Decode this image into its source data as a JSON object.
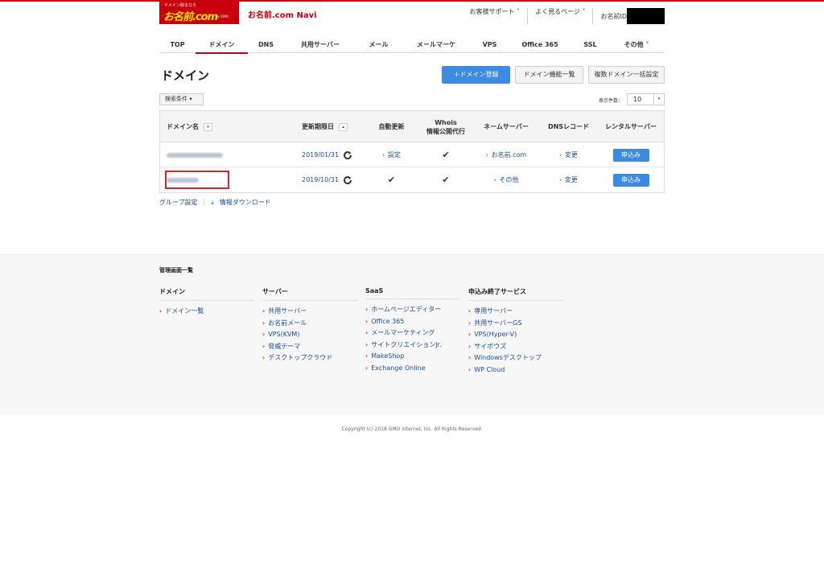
{
  "header": {
    "logo_tag": "ドメイン取るなら",
    "logo_main": "お名前.com",
    "logo_sub": "by GMO",
    "navi_title": "お名前.com Navi",
    "links": [
      "お客様サポート ˅",
      "よく見るページ ˅"
    ],
    "user_id_label": "お名前ID"
  },
  "gnav": [
    {
      "label": "TOP",
      "w": 45
    },
    {
      "label": "ドメイン",
      "w": 65,
      "active": true
    },
    {
      "label": "DNS",
      "w": 45
    },
    {
      "label": "共用サーバー",
      "w": 90
    },
    {
      "label": "メール",
      "w": 55
    },
    {
      "label": "メールマーケ",
      "w": 88
    },
    {
      "label": "VPS",
      "w": 45
    },
    {
      "label": "Office 365",
      "w": 80
    },
    {
      "label": "SSL",
      "w": 45
    },
    {
      "label": "その他 ˅",
      "w": 70
    }
  ],
  "page": {
    "title": "ドメイン",
    "register_button": "＋ドメイン登録",
    "features_button": "ドメイン機能一覧",
    "bulk_button": "複数ドメイン一括設定",
    "search_conditions": "検索条件 ▾",
    "display_count_label": "表示件数：",
    "display_count_value": "10"
  },
  "table": {
    "headers": {
      "domain": "ドメイン名",
      "expiry": "更新期限日",
      "auto_renew": "自動更新",
      "whois1": "Whois",
      "whois2": "情報公開代行",
      "nameserver": "ネームサーバー",
      "dns": "DNSレコード",
      "rental": "レンタルサーバー"
    },
    "rows": [
      {
        "expiry": "2019/01/31",
        "auto_renew": "設定",
        "whois": "✔",
        "nameserver": "お名前.com",
        "dns": "変更",
        "rental": "申込み"
      },
      {
        "expiry": "2019/10/31",
        "auto_renew": "✔",
        "whois": "✔",
        "nameserver": "その他",
        "dns": "変更",
        "rental": "申込み"
      }
    ]
  },
  "under_links": {
    "group": "グループ設定",
    "download": "情報ダウンロード"
  },
  "footer": {
    "title": "管理画面一覧",
    "columns": [
      {
        "heading": "ドメイン",
        "items": [
          "ドメイン一覧"
        ]
      },
      {
        "heading": "サーバー",
        "items": [
          "共用サーバー",
          "お名前メール",
          "VPS(KVM)",
          "脅威テーマ",
          "デスクトップクラウド"
        ]
      },
      {
        "heading": "SaaS",
        "items": [
          "ホームページエディター",
          "Office 365",
          "メールマーケティング",
          "サイトクリエイションJr.",
          "MakeShop",
          "Exchange Online"
        ]
      },
      {
        "heading": "申込み終了サービス",
        "items": [
          "専用サーバー",
          "共用サーバーGS",
          "VPS(Hyper-V)",
          "サイボウズ",
          "Windowsデスクトップ",
          "WP Cloud"
        ]
      }
    ],
    "copyright": "Copyright (c) 2018 GMO Internet, Inc. All Rights Reserved."
  }
}
